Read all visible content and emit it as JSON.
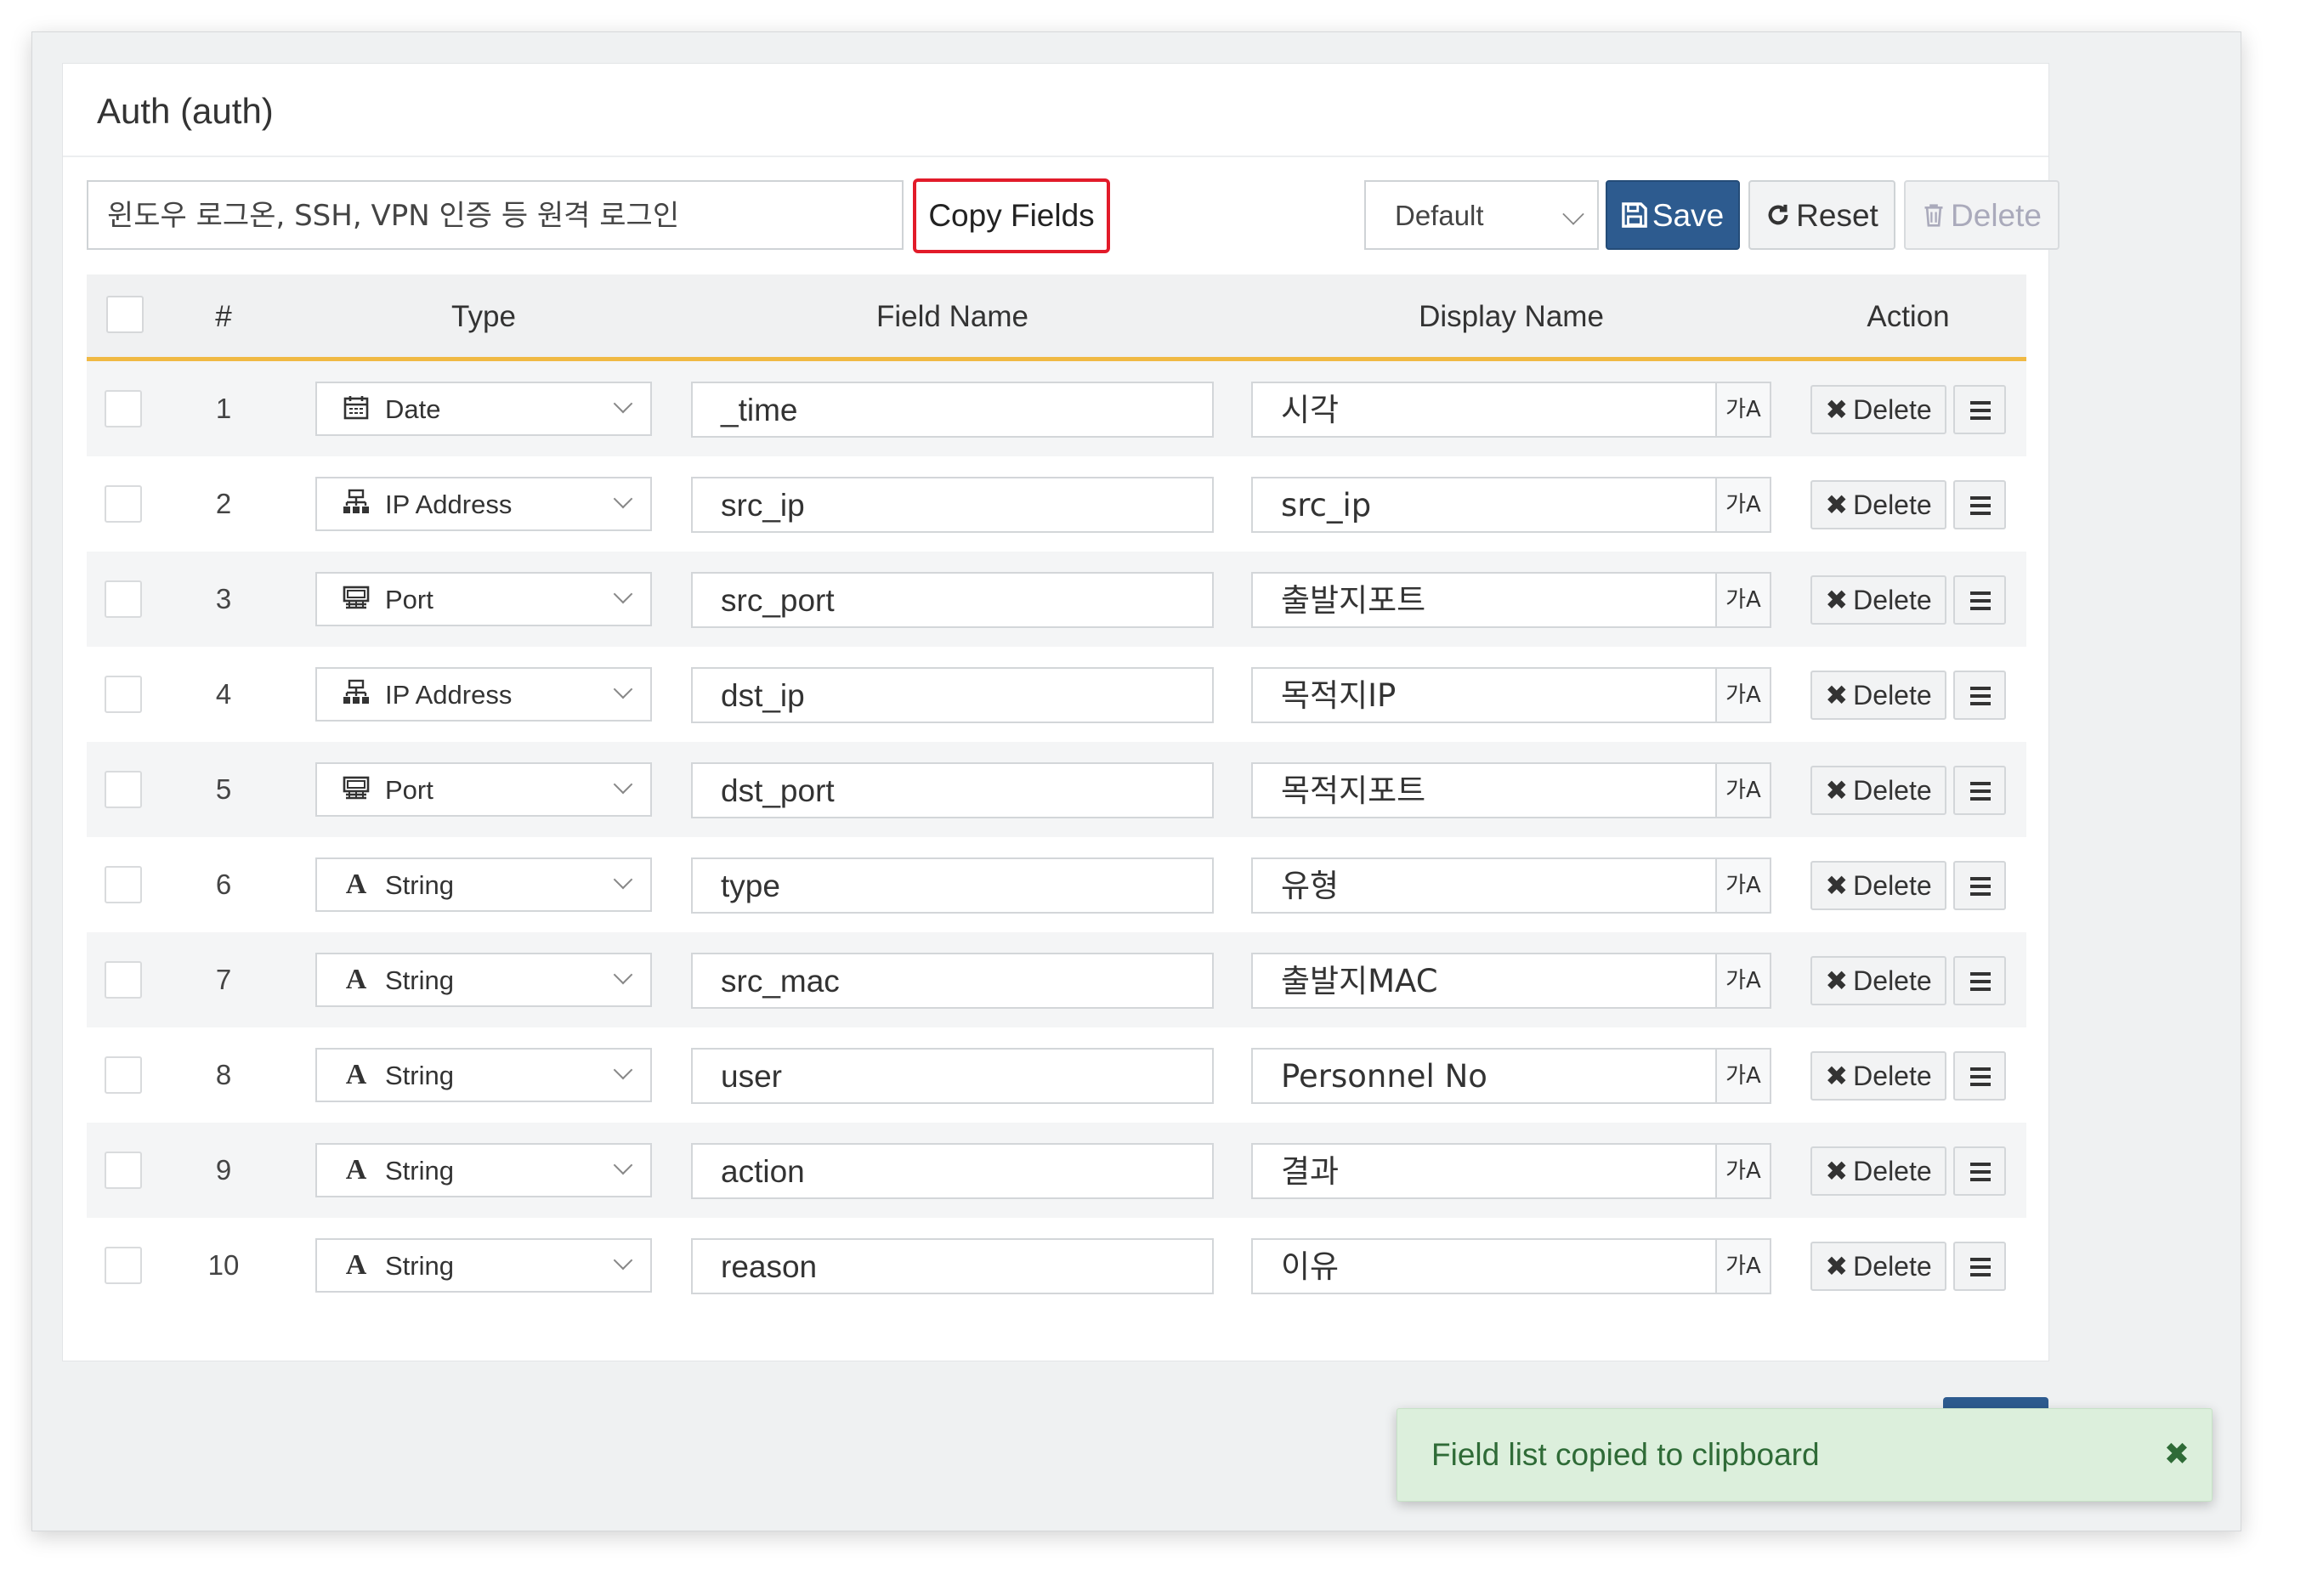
{
  "panel": {
    "title": "Auth (auth)"
  },
  "toolbar": {
    "description": "윈도우 로그온, SSH, VPN 인증 등 원격 로그인",
    "copy_fields_label": "Copy Fields",
    "profile_select": "Default",
    "save_label": "Save",
    "reset_label": "Reset",
    "delete_label": "Delete"
  },
  "table": {
    "headers": {
      "num": "#",
      "type": "Type",
      "field_name": "Field Name",
      "display_name": "Display Name",
      "action": "Action"
    },
    "translate_glyph": "가A",
    "row_delete_label": "Delete",
    "rows": [
      {
        "num": "1",
        "type": "Date",
        "type_icon": "calendar-icon",
        "field": "_time",
        "display": "시각"
      },
      {
        "num": "2",
        "type": "IP Address",
        "type_icon": "network-icon",
        "field": "src_ip",
        "display": "src_ip"
      },
      {
        "num": "3",
        "type": "Port",
        "type_icon": "port-icon",
        "field": "src_port",
        "display": "출발지포트"
      },
      {
        "num": "4",
        "type": "IP Address",
        "type_icon": "network-icon",
        "field": "dst_ip",
        "display": "목적지IP"
      },
      {
        "num": "5",
        "type": "Port",
        "type_icon": "port-icon",
        "field": "dst_port",
        "display": "목적지포트"
      },
      {
        "num": "6",
        "type": "String",
        "type_icon": "string-icon",
        "field": "type",
        "display": "유형"
      },
      {
        "num": "7",
        "type": "String",
        "type_icon": "string-icon",
        "field": "src_mac",
        "display": "출발지MAC"
      },
      {
        "num": "8",
        "type": "String",
        "type_icon": "string-icon",
        "field": "user",
        "display": "Personnel No"
      },
      {
        "num": "9",
        "type": "String",
        "type_icon": "string-icon",
        "field": "action",
        "display": "결과"
      },
      {
        "num": "10",
        "type": "String",
        "type_icon": "string-icon",
        "field": "reason",
        "display": "이유"
      }
    ]
  },
  "toast": {
    "message": "Field list copied to clipboard",
    "close_glyph": "✖"
  },
  "colors": {
    "primary": "#2d5b8f",
    "accent_border": "#f0b944",
    "highlight": "#e21b2a",
    "toast_bg": "#dcefdc"
  }
}
